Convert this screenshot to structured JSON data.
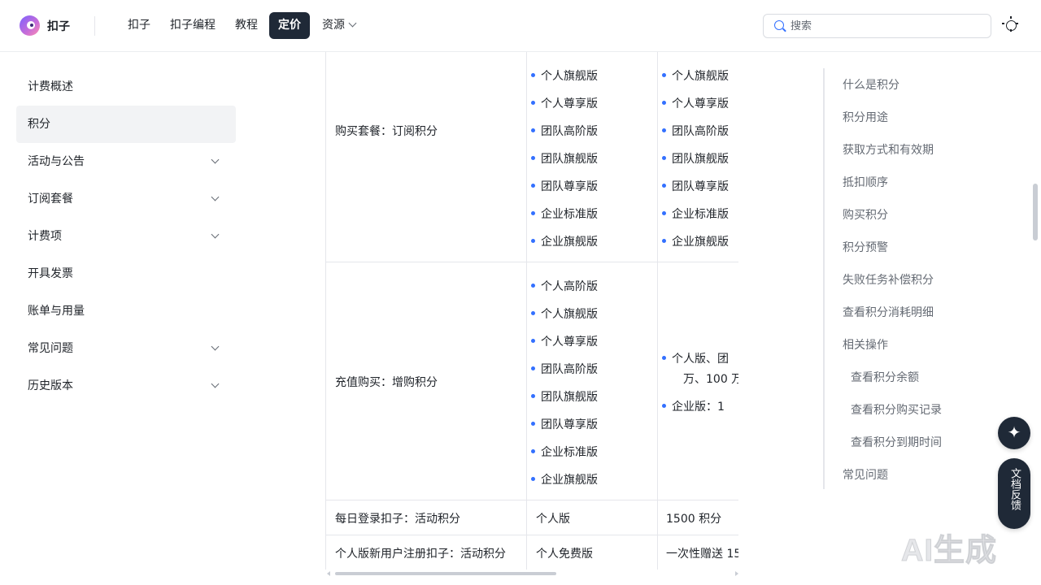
{
  "header": {
    "brand": "扣子",
    "nav": [
      {
        "label": "扣子"
      },
      {
        "label": "扣子编程"
      },
      {
        "label": "教程"
      },
      {
        "label": "定价"
      },
      {
        "label": "资源"
      }
    ],
    "active_nav": "定价",
    "search_placeholder": "搜索"
  },
  "sidebar": {
    "items": [
      {
        "label": "计费概述"
      },
      {
        "label": "积分"
      },
      {
        "label": "活动与公告"
      },
      {
        "label": "订阅套餐"
      },
      {
        "label": "计费项"
      },
      {
        "label": "开具发票"
      },
      {
        "label": "账单与用量"
      },
      {
        "label": "常见问题"
      },
      {
        "label": "历史版本"
      }
    ]
  },
  "table": {
    "row1": {
      "source": "购买套餐：订阅积分",
      "editions": [
        "个人旗舰版",
        "个人尊享版",
        "团队高阶版",
        "团队旗舰版",
        "团队尊享版",
        "企业标准版",
        "企业旗舰版"
      ],
      "amounts": [
        "个人旗舰版",
        "个人尊享版",
        "团队高阶版",
        "团队旗舰版",
        "团队尊享版",
        "企业标准版",
        "企业旗舰版"
      ]
    },
    "row2": {
      "source": "充值购买：增购积分",
      "editions": [
        "个人高阶版",
        "个人旗舰版",
        "个人尊享版",
        "团队高阶版",
        "团队旗舰版",
        "团队尊享版",
        "企业标准版",
        "企业旗舰版"
      ],
      "amount_a_line1": "个人版、团",
      "amount_a_line2": "万、100 万",
      "amount_b": "企业版：1"
    },
    "row3": {
      "source": "每日登录扣子：活动积分",
      "edition": "个人版",
      "amount": "1500 积分"
    },
    "row4": {
      "source": "个人版新用户注册扣子：活动积分",
      "edition": "个人免费版",
      "amount": "一次性赠送 15"
    }
  },
  "toc": {
    "items": [
      {
        "label": "什么是积分"
      },
      {
        "label": "积分用途"
      },
      {
        "label": "获取方式和有效期"
      },
      {
        "label": "抵扣顺序"
      },
      {
        "label": "购买积分"
      },
      {
        "label": "积分预警"
      },
      {
        "label": "失败任务补偿积分"
      },
      {
        "label": "查看积分消耗明细"
      },
      {
        "label": "相关操作"
      },
      {
        "label": "查看积分余额"
      },
      {
        "label": "查看积分购买记录"
      },
      {
        "label": "查看积分到期时间"
      },
      {
        "label": "常见问题"
      }
    ]
  },
  "floating": {
    "feedback_label": "文档反馈"
  },
  "watermark": "AI生成"
}
